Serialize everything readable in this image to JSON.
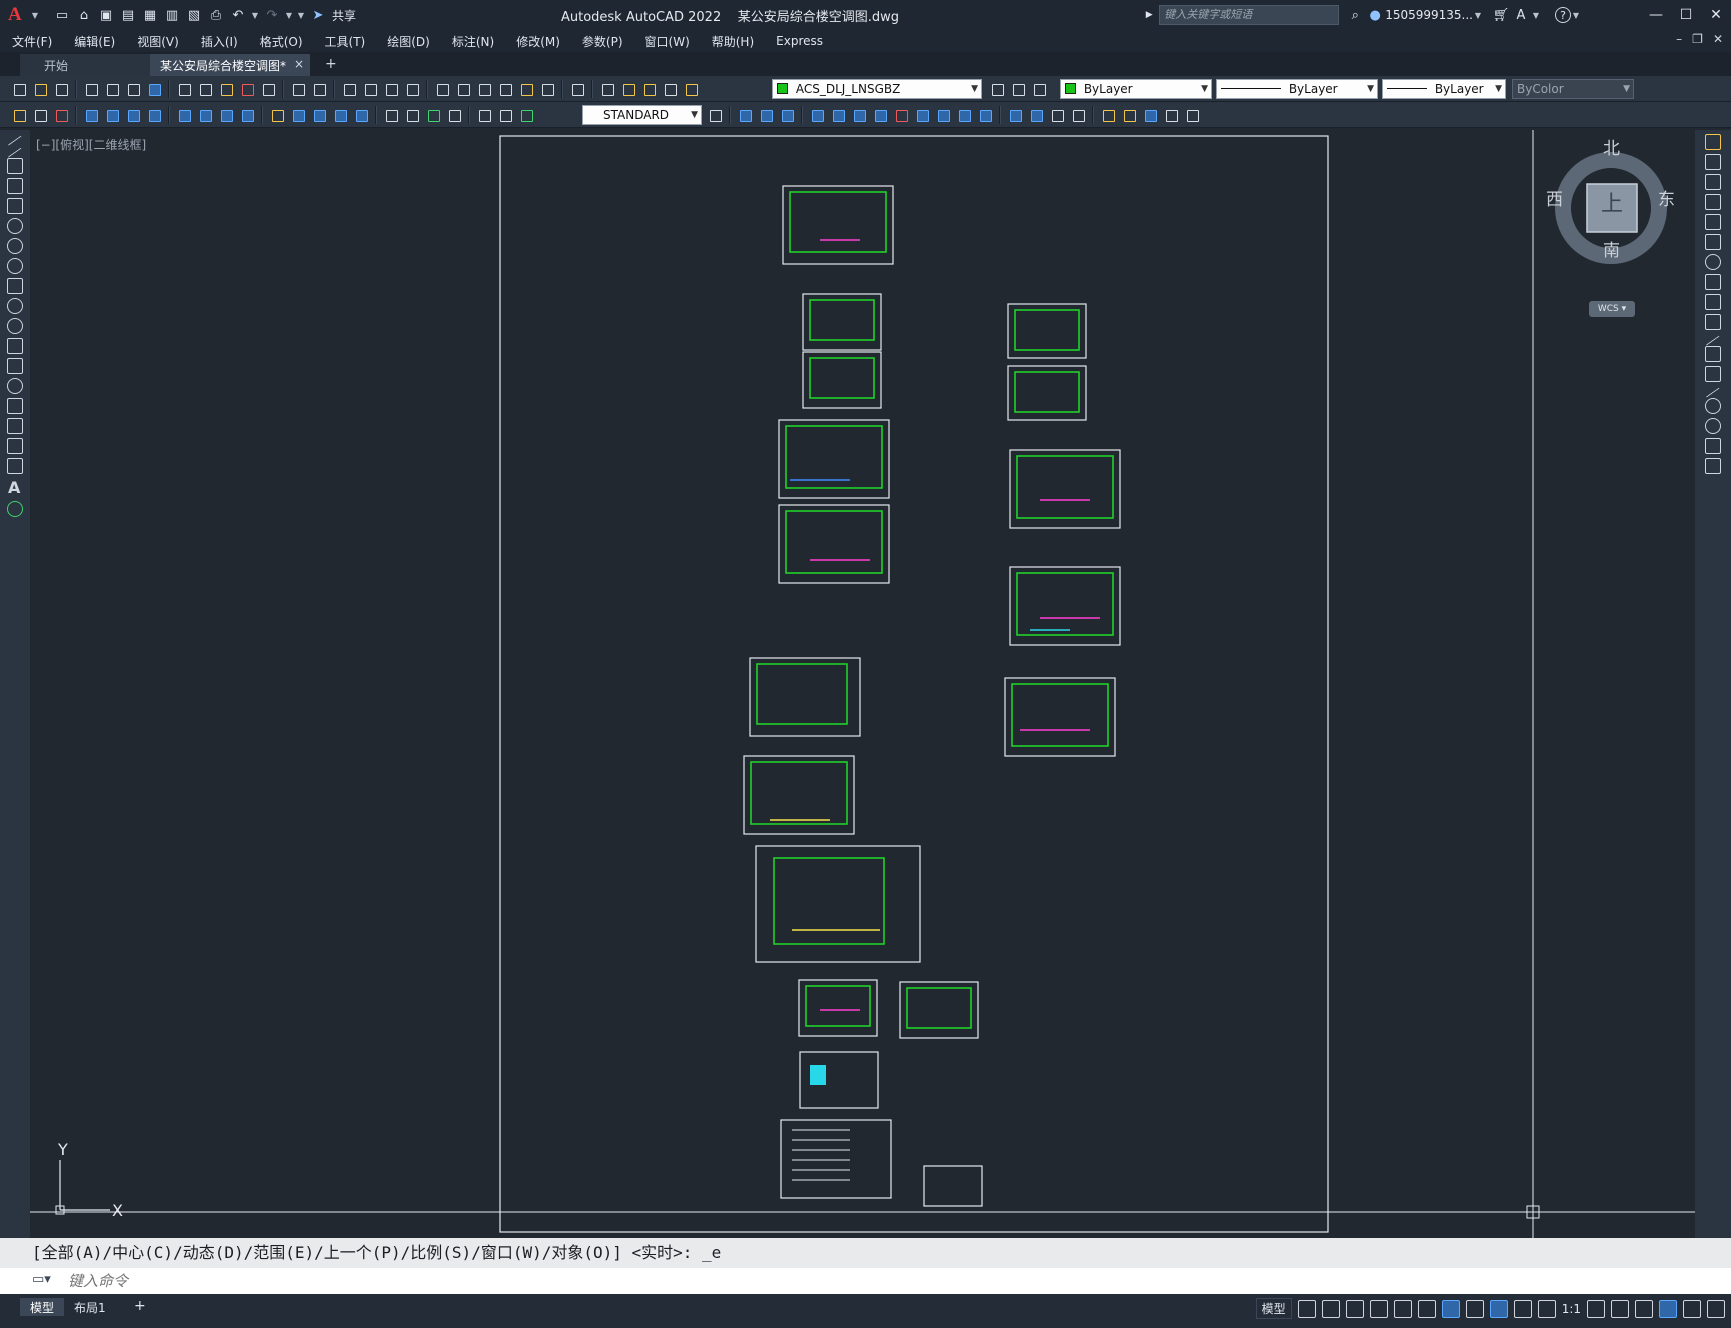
{
  "window": {
    "app_title": "Autodesk AutoCAD 2022",
    "file_name": "某公安局综合楼空调图.dwg"
  },
  "titlebar": {
    "share_label": "共享",
    "search_placeholder": "键入关键字或短语",
    "user_name": "1505999135...",
    "help_icon": "?"
  },
  "menu": {
    "items": [
      "文件(F)",
      "编辑(E)",
      "视图(V)",
      "插入(I)",
      "格式(O)",
      "工具(T)",
      "绘图(D)",
      "标注(N)",
      "修改(M)",
      "参数(P)",
      "窗口(W)",
      "帮助(H)",
      "Express"
    ]
  },
  "tabs": {
    "start": "开始",
    "drawing": "某公安局综合楼空调图*",
    "close": "×",
    "add": "+"
  },
  "toolbar": {
    "layer_name": "ACS_DLJ_LNSGBZ",
    "color": "ByLayer",
    "linetype": "ByLayer",
    "lineweight": "ByLayer",
    "plotstyle": "ByColor",
    "text_style": "STANDARD",
    "layer_color_hex": "#18c41a"
  },
  "viewport": {
    "label": "[−][俯视][二维线框]",
    "viewcube": {
      "north": "北",
      "south": "南",
      "east": "东",
      "west": "西",
      "top_face": "上"
    },
    "wcs": "WCS ▾",
    "ucs_x": "X",
    "ucs_y": "Y"
  },
  "command": {
    "history": "[全部(A)/中心(C)/动态(D)/范围(E)/上一个(P)/比例(S)/窗口(W)/对象(O)] <实时>: _e",
    "placeholder": "键入命令"
  },
  "status": {
    "tab_model": "模型",
    "tab_layout1": "布局1",
    "add": "+",
    "model_label": "模型",
    "scale": "1:1"
  }
}
